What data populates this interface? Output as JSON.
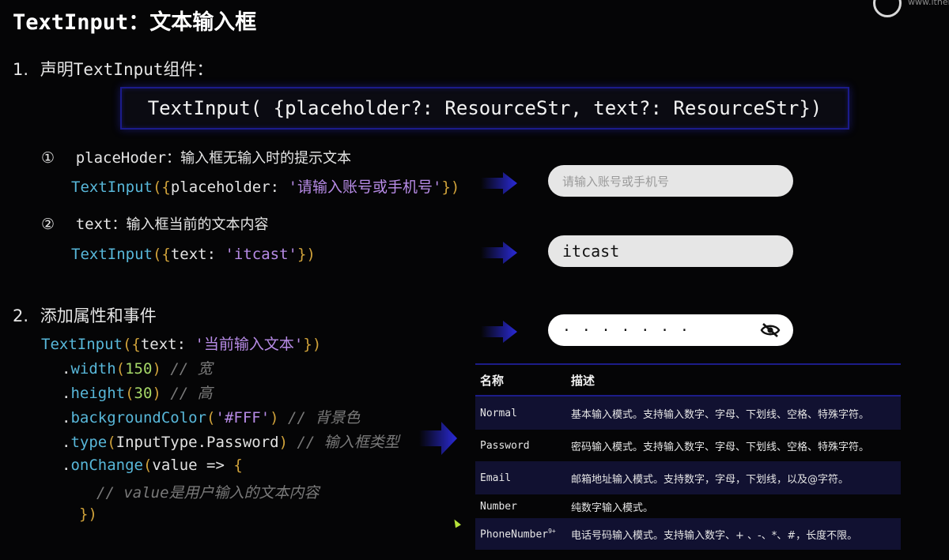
{
  "title": "TextInput：文本输入框",
  "corner": {
    "text": "www.itheima"
  },
  "section1": {
    "number": "1.",
    "label_prefix": "声明",
    "label_code": "TextInput",
    "label_suffix": "组件："
  },
  "signature": "TextInput( {placeholder?: ResourceStr, text?: ResourceStr})",
  "item1": {
    "marker": "①",
    "name": "placeHoder",
    "desc": "：输入框无输入时的提示文本",
    "code_fn": "TextInput",
    "code_open": "({",
    "code_key": "placeholder: ",
    "code_str": "'请输入账号或手机号'",
    "code_close": "})",
    "preview_placeholder": "请输入账号或手机号"
  },
  "item2": {
    "marker": "②",
    "name": "text",
    "desc": "：输入框当前的文本内容",
    "code_fn": "TextInput",
    "code_open": "({",
    "code_key": "text: ",
    "code_str": "'itcast'",
    "code_close": "})",
    "preview_value": "itcast"
  },
  "section2": {
    "number": "2.",
    "label": "添加属性和事件"
  },
  "code2": {
    "l1_fn": "TextInput",
    "l1_open": "({",
    "l1_key": "text: ",
    "l1_str": "'当前输入文本'",
    "l1_close": "})",
    "l2_dot": ".",
    "l2_fn": "width",
    "l2_open": "(",
    "l2_num": "150",
    "l2_close": ")",
    "l2_cm": " // 宽",
    "l3_dot": ".",
    "l3_fn": "height",
    "l3_open": "(",
    "l3_num": "30",
    "l3_close": ")",
    "l3_cm": " // 高",
    "l4_dot": ".",
    "l4_fn": "backgroundColor",
    "l4_open": "(",
    "l4_str": "'#FFF'",
    "l4_close": ")",
    "l4_cm": " // 背景色",
    "l5_dot": ".",
    "l5_fn": "type",
    "l5_open": "(",
    "l5_arg": "InputType.Password",
    "l5_close": ")",
    "l5_cm": " // 输入框类型",
    "l6_dot": ".",
    "l6_fn": "onChange",
    "l6_open": "(",
    "l6_arg": "value => ",
    "l6_brace": "{",
    "l7_cm": "// value是用户输入的文本内容",
    "l8_close": "})"
  },
  "password_preview": {
    "dots": "·······",
    "icon": "eye-off-icon"
  },
  "table": {
    "headers": [
      "名称",
      "描述"
    ],
    "rows": [
      {
        "name": "Normal",
        "desc": "基本输入模式。支持输入数字、字母、下划线、空格、特殊字符。"
      },
      {
        "name": "Password",
        "desc": "密码输入模式。支持输入数字、字母、下划线、空格、特殊字符。"
      },
      {
        "name": "Email",
        "desc": "邮箱地址输入模式。支持数字，字母，下划线，以及@字符。"
      },
      {
        "name": "Number",
        "desc": "纯数字输入模式。"
      },
      {
        "name": "PhoneNumber",
        "sup": "9+",
        "desc": "电话号码输入模式。支持输入数字、+ 、-、*、#，长度不限。"
      }
    ]
  },
  "colors": {
    "accent_border": "#1c1c88",
    "arrow": "#2a2ad8",
    "function": "#58b7d9",
    "string": "#b78be6",
    "number": "#a6d868",
    "comment": "#7a7a7a"
  }
}
